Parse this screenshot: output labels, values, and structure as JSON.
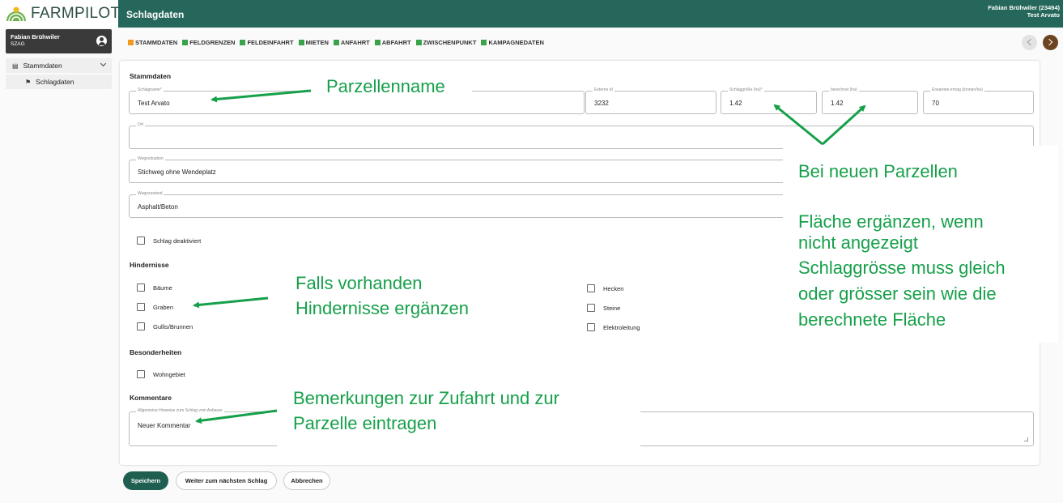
{
  "app": {
    "logo_text": "FARMPILOT",
    "title": "Schlagdaten"
  },
  "user_box": {
    "name": "Fabian Brühwiler",
    "org": "SZAG"
  },
  "header_user": {
    "line1": "Fabian Brühwiler (23494)",
    "line2": "Test Arvato"
  },
  "sidebar": {
    "parent": {
      "label": "Stammdaten",
      "icon": "book-icon"
    },
    "child": {
      "label": "Schlagdaten",
      "icon": "flag-icon"
    }
  },
  "tabs": [
    "STAMMDATEN",
    "FELDGRENZEN",
    "FELDEINFAHRT",
    "MIETEN",
    "ANFAHRT",
    "ABFAHRT",
    "ZWISCHENPUNKT",
    "KAMPAGNEDATEN"
  ],
  "form": {
    "section_stammdaten": "Stammdaten",
    "schlagname": {
      "label": "Schlagname*",
      "value": "Test Arvato"
    },
    "externe_id": {
      "label": "Externe Id",
      "value": "3232"
    },
    "schlaggroesse": {
      "label": "Schlaggröße (ha)*",
      "value": "1.42"
    },
    "berechnet": {
      "label": "berechnet (ha)",
      "value": "1.42"
    },
    "ertrag": {
      "label": "Erwartete ertrag (tonnen/ha)",
      "value": "70"
    },
    "ort": {
      "label": "Ort",
      "value": ""
    },
    "wegesituation": {
      "label": "Wegesituation",
      "value": "Stichweg ohne Wendeplatz"
    },
    "wegezustand": {
      "label": "Wegezustand",
      "value": "Asphalt/Beton"
    },
    "deaktiviert": "Schlag deaktiviert",
    "section_hindernisse": "Hindernisse",
    "hindernisse_left": [
      "Bäume",
      "Graben",
      "Gullis/Brunnen"
    ],
    "hindernisse_right": [
      "Hecken",
      "Steine",
      "Elektroleitung"
    ],
    "section_besonderheiten": "Besonderheiten",
    "wohngebiet": "Wohngebiet",
    "section_kommentare": "Kommentare",
    "kommentar": {
      "label": "Allgemeine Hinweise zum Schlag vom Anbauer",
      "value": "Neuer Kommentar"
    }
  },
  "buttons": {
    "save": "Speichern",
    "next": "Weiter zum nächsten Schlag",
    "cancel": "Abbrechen"
  },
  "annotations": {
    "parzellenname": "Parzellenname",
    "neue_parzellen": "Bei neuen Parzellen",
    "flaeche": [
      "Fläche ergänzen, wenn",
      "nicht angezeigt",
      "Schlaggrösse muss gleich",
      "oder grösser sein wie die",
      "berechnete Fläche"
    ],
    "hindernisse": [
      "Falls vorhanden",
      "Hindernisse ergänzen"
    ],
    "bemerkungen": [
      "Bemerkungen zur Zufahrt und zur",
      "Parzelle eintragen"
    ]
  },
  "colors": {
    "header": "#26675b",
    "active_tab": "#f29a1f",
    "tab_marker": "#3aa34a",
    "annotation": "#16a04a",
    "primary_button": "#1f5f52"
  }
}
